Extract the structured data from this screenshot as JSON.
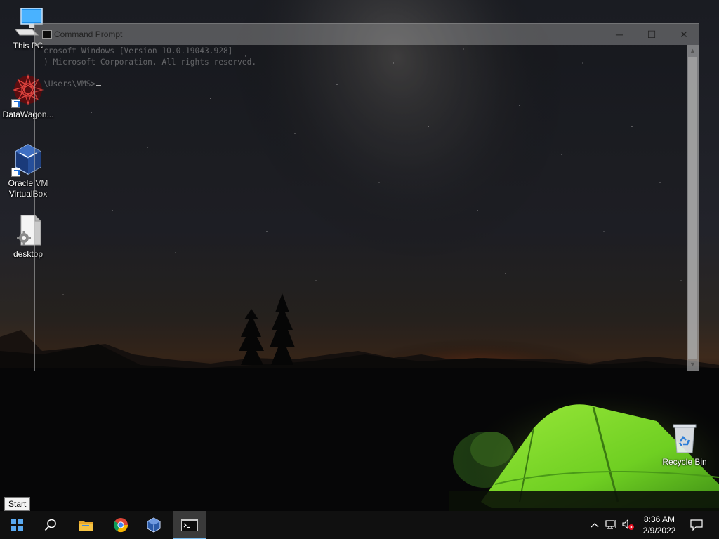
{
  "desktop": {
    "icons": [
      {
        "label": "This PC"
      },
      {
        "label": "DataWagon..."
      },
      {
        "label_line1": "Oracle VM",
        "label_line2": "VirtualBox"
      },
      {
        "label": "desktop"
      },
      {
        "label": "Recycle Bin"
      }
    ]
  },
  "cmd": {
    "title": "Command Prompt",
    "lines": [
      "crosoft Windows [Version 10.0.19043.928]",
      ") Microsoft Corporation. All rights reserved.",
      "",
      "\\Users\\VMS>"
    ],
    "controls": {
      "minimize": "─",
      "maximize": "☐",
      "close": "✕"
    }
  },
  "tooltip": {
    "text": "Start"
  },
  "taskbar": {
    "pinned": [
      {
        "icon": "windows-start-icon"
      },
      {
        "icon": "search-icon"
      },
      {
        "icon": "file-explorer-icon"
      },
      {
        "icon": "chrome-icon"
      },
      {
        "icon": "virtualbox-icon"
      },
      {
        "icon": "command-prompt-icon",
        "active": true
      }
    ],
    "tray": {
      "icons": [
        "chevron-up-icon",
        "network-icon",
        "volume-muted-icon"
      ],
      "time": "8:36 AM",
      "date": "2/9/2022",
      "notification_icon": "action-center-icon"
    }
  },
  "colors": {
    "taskbar": "#101010",
    "active_indicator": "#76b9ed",
    "tent": "#7fd32a"
  }
}
